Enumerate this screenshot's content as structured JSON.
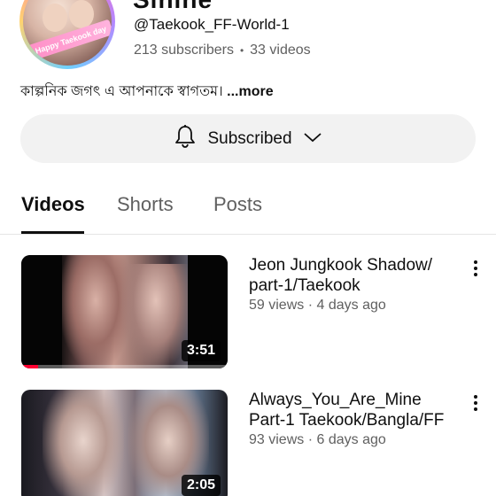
{
  "channel": {
    "name_partial": "Sinine",
    "avatar_text": "Happy Taekook day",
    "handle": "@Taekook_FF-World-1",
    "subscribers": "213 subscribers",
    "videos_count": "33 videos",
    "description": "কাল্পনিক জগৎ এ আপনাকে স্বাগতম।",
    "more_label": "...more"
  },
  "subscribe": {
    "label": "Subscribed",
    "icon": "bell-icon",
    "dropdown_icon": "chevron-down-icon"
  },
  "tabs": [
    {
      "label": "Videos",
      "active": true
    },
    {
      "label": "Shorts",
      "active": false
    },
    {
      "label": "Posts",
      "active": false
    }
  ],
  "videos": [
    {
      "title": "Jeon Jungkook Shadow/ part-1/Taekook",
      "views": "59 views",
      "age": "4 days ago",
      "duration": "3:51",
      "watched_fraction": 0.08
    },
    {
      "title": "Always_You_Are_Mine Part-1 Taekook/Bangla/FF",
      "views": "93 views",
      "age": "6 days ago",
      "duration": "2:05",
      "watched_fraction": 0
    }
  ],
  "colors": {
    "accent": "#ff0033",
    "text_primary": "#0f0f0f",
    "text_secondary": "#606060",
    "button_bg": "#f2f2f2"
  }
}
